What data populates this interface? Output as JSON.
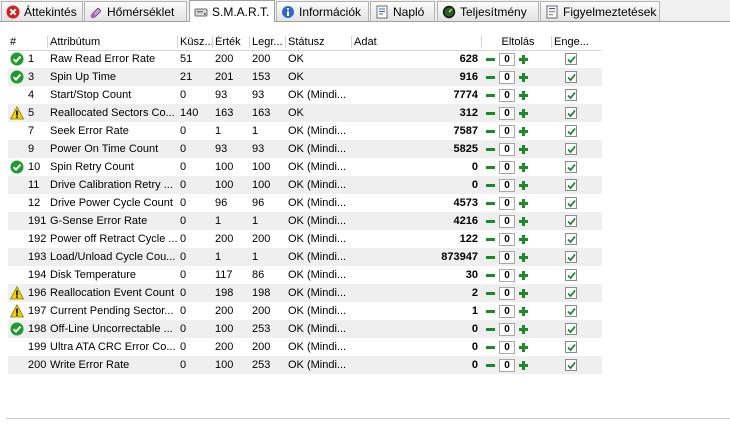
{
  "tabs": [
    {
      "label": "Áttekintés",
      "icon": "close-red-icon",
      "active": false
    },
    {
      "label": "Hőmérséklet",
      "icon": "thermometer-icon",
      "active": false
    },
    {
      "label": "S.M.A.R.T.",
      "icon": "hard-drive-icon",
      "active": true
    },
    {
      "label": "Információk",
      "icon": "info-icon",
      "active": false
    },
    {
      "label": "Napló",
      "icon": "log-icon",
      "active": false
    },
    {
      "label": "Teljesítmény",
      "icon": "performance-icon",
      "active": false
    },
    {
      "label": "Figyelmeztetések",
      "icon": "warnings-icon",
      "active": false
    }
  ],
  "table": {
    "columns": [
      "#",
      "Attribútum",
      "Küsz...",
      "Érték",
      "Legr...",
      "Státusz",
      "Adat",
      "Eltolás",
      "Enge..."
    ],
    "rows": [
      {
        "status": "ok",
        "id": "1",
        "attribute": "Raw Read Error Rate",
        "threshold": "51",
        "value": "200",
        "worst": "200",
        "state": "OK",
        "data": "628",
        "offset": "0",
        "enabled": true
      },
      {
        "status": "ok",
        "id": "3",
        "attribute": "Spin Up Time",
        "threshold": "21",
        "value": "201",
        "worst": "153",
        "state": "OK",
        "data": "916",
        "offset": "0",
        "enabled": true
      },
      {
        "status": "none",
        "id": "4",
        "attribute": "Start/Stop Count",
        "threshold": "0",
        "value": "93",
        "worst": "93",
        "state": "OK (Mindi...",
        "data": "7774",
        "offset": "0",
        "enabled": true
      },
      {
        "status": "warn",
        "id": "5",
        "attribute": "Reallocated Sectors Co...",
        "threshold": "140",
        "value": "163",
        "worst": "163",
        "state": "OK",
        "data": "312",
        "offset": "0",
        "enabled": true
      },
      {
        "status": "none",
        "id": "7",
        "attribute": "Seek Error Rate",
        "threshold": "0",
        "value": "1",
        "worst": "1",
        "state": "OK (Mindi...",
        "data": "7587",
        "offset": "0",
        "enabled": true
      },
      {
        "status": "none",
        "id": "9",
        "attribute": "Power On Time Count",
        "threshold": "0",
        "value": "93",
        "worst": "93",
        "state": "OK (Mindi...",
        "data": "5825",
        "offset": "0",
        "enabled": true
      },
      {
        "status": "ok",
        "id": "10",
        "attribute": "Spin Retry Count",
        "threshold": "0",
        "value": "100",
        "worst": "100",
        "state": "OK (Mindi...",
        "data": "0",
        "offset": "0",
        "enabled": true
      },
      {
        "status": "none",
        "id": "11",
        "attribute": "Drive Calibration Retry ...",
        "threshold": "0",
        "value": "100",
        "worst": "100",
        "state": "OK (Mindi...",
        "data": "0",
        "offset": "0",
        "enabled": true
      },
      {
        "status": "none",
        "id": "12",
        "attribute": "Drive Power Cycle Count",
        "threshold": "0",
        "value": "96",
        "worst": "96",
        "state": "OK (Mindi...",
        "data": "4573",
        "offset": "0",
        "enabled": true
      },
      {
        "status": "none",
        "id": "191",
        "attribute": "G-Sense Error Rate",
        "threshold": "0",
        "value": "1",
        "worst": "1",
        "state": "OK (Mindi...",
        "data": "4216",
        "offset": "0",
        "enabled": true
      },
      {
        "status": "none",
        "id": "192",
        "attribute": "Power off Retract Cycle ...",
        "threshold": "0",
        "value": "200",
        "worst": "200",
        "state": "OK (Mindi...",
        "data": "122",
        "offset": "0",
        "enabled": true
      },
      {
        "status": "none",
        "id": "193",
        "attribute": "Load/Unload Cycle Cou...",
        "threshold": "0",
        "value": "1",
        "worst": "1",
        "state": "OK (Mindi...",
        "data": "873947",
        "offset": "0",
        "enabled": true
      },
      {
        "status": "none",
        "id": "194",
        "attribute": "Disk Temperature",
        "threshold": "0",
        "value": "117",
        "worst": "86",
        "state": "OK (Mindi...",
        "data": "30",
        "offset": "0",
        "enabled": true
      },
      {
        "status": "warn",
        "id": "196",
        "attribute": "Reallocation Event Count",
        "threshold": "0",
        "value": "198",
        "worst": "198",
        "state": "OK (Mindi...",
        "data": "2",
        "offset": "0",
        "enabled": true
      },
      {
        "status": "warn",
        "id": "197",
        "attribute": "Current Pending Sector...",
        "threshold": "0",
        "value": "200",
        "worst": "200",
        "state": "OK (Mindi...",
        "data": "1",
        "offset": "0",
        "enabled": true
      },
      {
        "status": "ok",
        "id": "198",
        "attribute": "Off-Line Uncorrectable ...",
        "threshold": "0",
        "value": "100",
        "worst": "253",
        "state": "OK (Mindi...",
        "data": "0",
        "offset": "0",
        "enabled": true
      },
      {
        "status": "none",
        "id": "199",
        "attribute": "Ultra ATA CRC Error Co...",
        "threshold": "0",
        "value": "200",
        "worst": "200",
        "state": "OK (Mindi...",
        "data": "0",
        "offset": "0",
        "enabled": true
      },
      {
        "status": "none",
        "id": "200",
        "attribute": "Write Error Rate",
        "threshold": "0",
        "value": "100",
        "worst": "253",
        "state": "OK (Mindi...",
        "data": "0",
        "offset": "0",
        "enabled": true
      }
    ]
  },
  "colors": {
    "ok_green": "#1f9a2e",
    "warn_yellow": "#f2d200",
    "stepper_green": "#1a8a2a",
    "alt_row": "#efefef",
    "error_red": "#d42020"
  }
}
